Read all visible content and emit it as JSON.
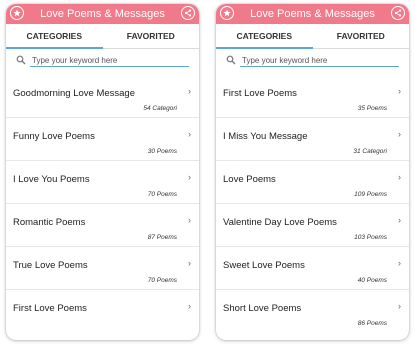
{
  "left": {
    "appbar": {
      "title": "Love Poems & Messages",
      "accent": "#f0798a"
    },
    "tabs": [
      {
        "label": "CATEGORIES",
        "active": true
      },
      {
        "label": "FAVORITED",
        "active": false
      }
    ],
    "search": {
      "placeholder": "Type your keyword here"
    },
    "items": [
      {
        "name": "Goodmorning Love Message",
        "count": "54 Categori"
      },
      {
        "name": "Funny Love Poems",
        "count": "30 Poems"
      },
      {
        "name": "I Love You Poems",
        "count": "70 Poems"
      },
      {
        "name": "Romantic Poems",
        "count": "87 Poems"
      },
      {
        "name": "True Love Poems",
        "count": "70 Poems"
      },
      {
        "name": "First Love Poems",
        "count": ""
      }
    ]
  },
  "right": {
    "appbar": {
      "title": "Love Poems & Messages",
      "accent": "#f0798a"
    },
    "tabs": [
      {
        "label": "CATEGORIES",
        "active": true
      },
      {
        "label": "FAVORITED",
        "active": false
      }
    ],
    "search": {
      "placeholder": "Type your keyword here"
    },
    "items": [
      {
        "name": "First Love Poems",
        "count": "35 Poems"
      },
      {
        "name": "I Miss You Message",
        "count": "31 Categori"
      },
      {
        "name": "Love Poems",
        "count": "109 Poems"
      },
      {
        "name": "Valentine Day Love Poems",
        "count": "103 Poems"
      },
      {
        "name": "Sweet Love Poems",
        "count": "40 Poems"
      },
      {
        "name": "Short Love Poems",
        "count": "86 Poems"
      }
    ]
  }
}
